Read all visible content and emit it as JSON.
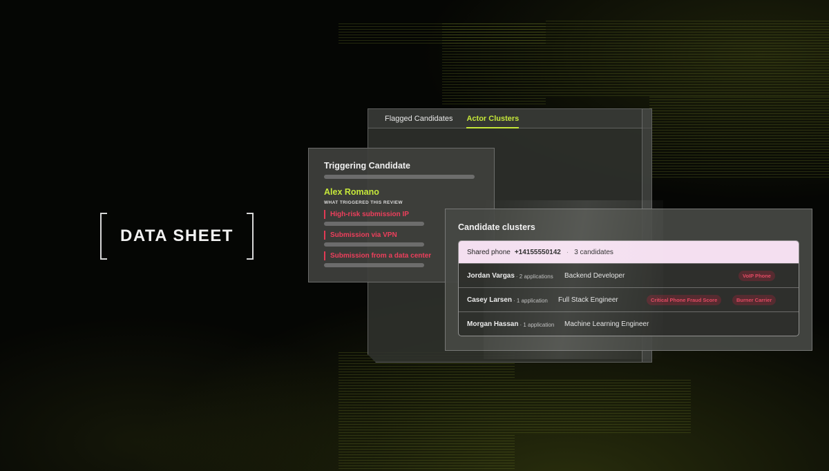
{
  "label": "DATA SHEET",
  "tabs": [
    "Flagged Candidates",
    "Actor Clusters"
  ],
  "trigger": {
    "title": "Triggering Candidate",
    "name": "Alex Romano",
    "subtitle": "WHAT TRIGGERED THIS REVIEW",
    "reasons": [
      "High-risk submission IP",
      "Submission via VPN",
      "Submission from a data center"
    ]
  },
  "clusters": {
    "title": "Candidate clusters",
    "header": {
      "label": "Shared phone",
      "phone": "+14155550142",
      "separator": "·",
      "count": "3 candidates"
    },
    "rows": [
      {
        "name": "Jordan Vargas",
        "apps": "· 2 applications",
        "role": "Backend Developer",
        "tags": [
          "VoIP Phone"
        ]
      },
      {
        "name": "Casey Larsen",
        "apps": "· 1 application",
        "role": "Full Stack Engineer",
        "tags": [
          "Critical Phone Fraud Score",
          "Burner Carrier"
        ]
      },
      {
        "name": "Morgan Hassan",
        "apps": "· 1 application",
        "role": "Machine Learning Engineer",
        "tags": []
      }
    ]
  },
  "colors": {
    "accent": "#c6e83a",
    "alert": "#ee3f5c",
    "highlight": "#f4dff0"
  }
}
